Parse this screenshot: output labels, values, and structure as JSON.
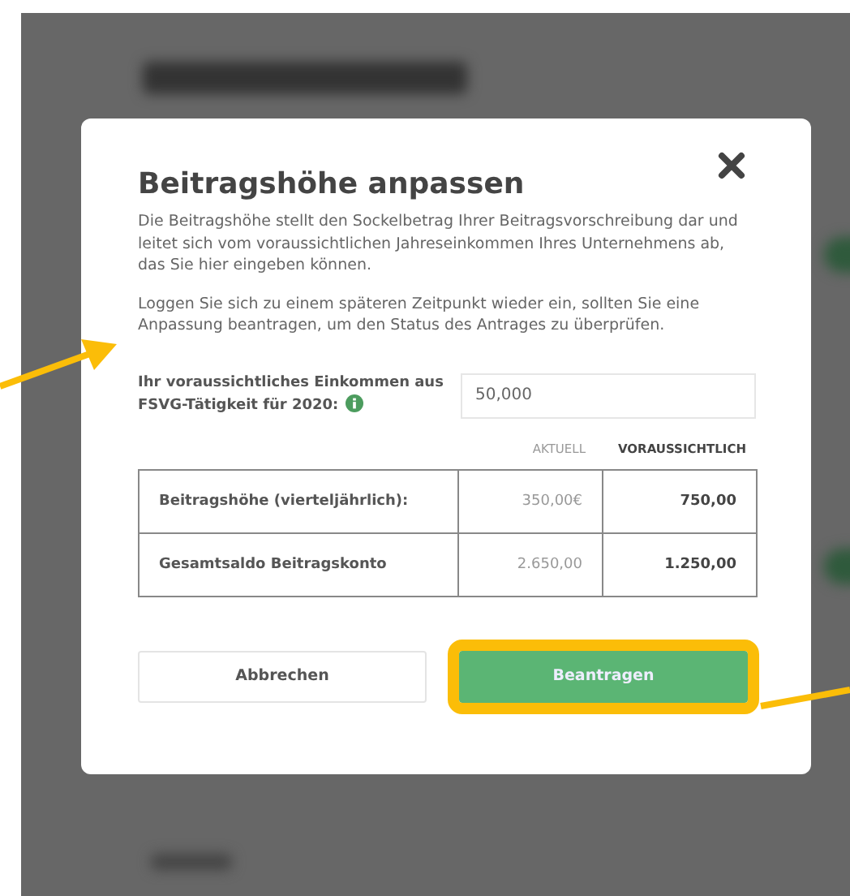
{
  "modal": {
    "title": "Beitragshöhe anpassen",
    "paragraphs": [
      "Die Beitragshöhe stellt den Sockelbetrag Ihrer Beitragsvorschreibung dar und leitet sich vom voraussichtlichen Jahreseinkommen Ihres Unternehmens ab, das Sie hier eingeben können.",
      "Loggen Sie sich zu einem späteren Zeitpunkt wieder ein, sollten Sie eine Anpassung beantragen, um den Status des Antrages zu überprüfen."
    ],
    "income_label": "Ihr voraussichtliches Einkommen aus FSVG-Tätigkeit für 2020:",
    "income_value": "50,000",
    "table": {
      "columns": [
        "AKTUELL",
        "VORAUSSICHTLICH"
      ],
      "rows": [
        {
          "label": "Beitragshöhe (vierteljährlich):",
          "current": "350,00€",
          "expected": "750,00"
        },
        {
          "label": "Gesamtsaldo Beitragskonto",
          "current": "2.650,00",
          "expected": "1.250,00"
        }
      ]
    },
    "buttons": [
      {
        "label": "Abbrechen",
        "kind": "secondary",
        "highlighted": false
      },
      {
        "label": "Beantragen",
        "kind": "primary",
        "highlighted": true
      }
    ]
  }
}
